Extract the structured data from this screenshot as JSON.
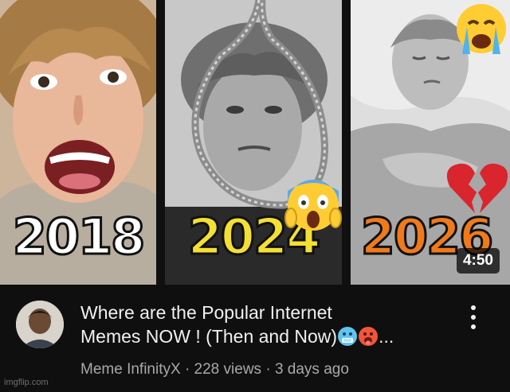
{
  "thumbnail": {
    "panels": [
      {
        "year": "2018"
      },
      {
        "year": "2024"
      },
      {
        "year": "2026"
      }
    ],
    "duration": "4:50",
    "emojis": [
      "crying-face",
      "screaming-face",
      "broken-heart"
    ]
  },
  "video": {
    "title_line1": "Where are the Popular Internet",
    "title_line2": "Memes NOW ! (Then and Now)",
    "title_ellipsis": "...",
    "title_emojis": [
      "cold-face",
      "hot-face"
    ],
    "channel": "Meme InfinityX",
    "separator": "·",
    "views": "228 views",
    "age": "3 days ago"
  },
  "watermark": "imgflip.com",
  "colors": {
    "background": "#0f0f0f",
    "title_text": "#f1f1f1",
    "secondary_text": "#a9a9a9",
    "year_2018": "#ffffff",
    "year_2024": "#f4e033",
    "year_2026": "#f07a1a"
  }
}
